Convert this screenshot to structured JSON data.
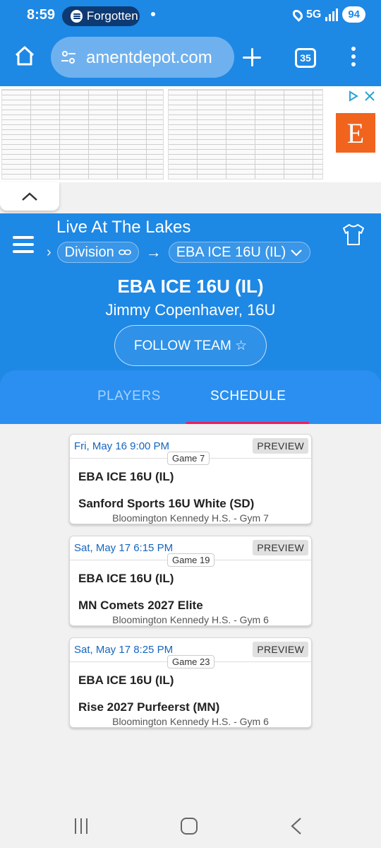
{
  "status_bar": {
    "time": "8:59",
    "media_app": "Forgotten",
    "network": "5G",
    "battery": "94"
  },
  "browser": {
    "url": "amentdepot.com",
    "tab_count": "35"
  },
  "ad": {
    "etsy_letter": "E"
  },
  "header": {
    "event_name": "Live At The Lakes",
    "breadcrumb_division": "Division",
    "breadcrumb_team": "EBA ICE 16U (IL)",
    "team_name": "EBA ICE 16U (IL)",
    "team_subtitle": "Jimmy Copenhaver, 16U",
    "follow_label": "FOLLOW TEAM ☆"
  },
  "tabs": [
    {
      "label": "PLAYERS",
      "active": false
    },
    {
      "label": "SCHEDULE",
      "active": true
    }
  ],
  "games": [
    {
      "date": "Fri, May 16 9:00 PM",
      "status": "PREVIEW",
      "game": "Game 7",
      "home": "EBA ICE 16U (IL)",
      "away": "Sanford Sports 16U White (SD)",
      "venue": "Bloomington Kennedy H.S. - Gym 7"
    },
    {
      "date": "Sat, May 17 6:15 PM",
      "status": "PREVIEW",
      "game": "Game 19",
      "home": "EBA ICE 16U (IL)",
      "away": "MN Comets 2027 Elite",
      "venue": "Bloomington Kennedy H.S. - Gym 6"
    },
    {
      "date": "Sat, May 17 8:25 PM",
      "status": "PREVIEW",
      "game": "Game 23",
      "home": "EBA ICE 16U (IL)",
      "away": "Rise 2027 Purfeerst (MN)",
      "venue": "Bloomington Kennedy H.S. - Gym 6"
    }
  ],
  "colors": {
    "primary": "#1e88e5",
    "tab_indicator": "#e91e63",
    "date_text": "#1565c0"
  }
}
